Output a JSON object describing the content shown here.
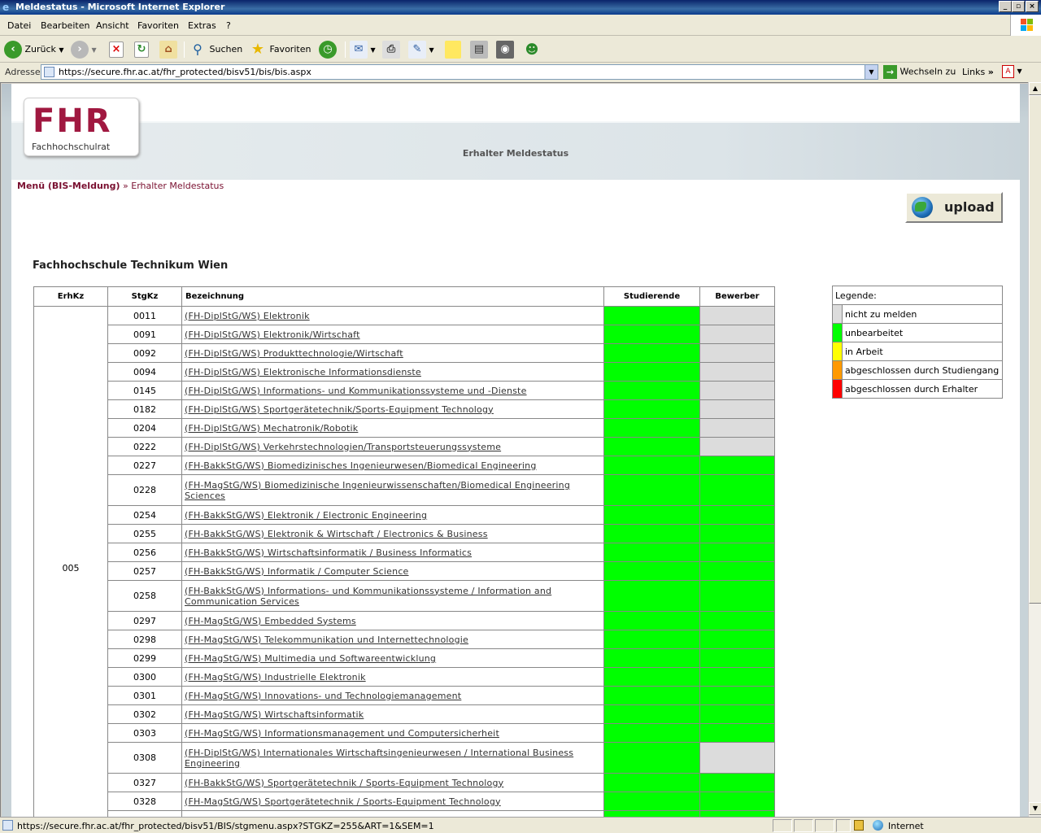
{
  "window": {
    "title": "Meldestatus - Microsoft Internet Explorer"
  },
  "menubar": [
    "Datei",
    "Bearbeiten",
    "Ansicht",
    "Favoriten",
    "Extras",
    "?"
  ],
  "toolbar": {
    "back": "Zurück",
    "search": "Suchen",
    "favorites": "Favoriten"
  },
  "address": {
    "label": "Adresse",
    "url": "https://secure.fhr.ac.at/fhr_protected/bisv51/bis/bis.aspx",
    "go": "Wechseln zu",
    "links": "Links"
  },
  "header": {
    "logo": "FHR",
    "logo_sub": "Fachhochschulrat",
    "title": "Erhalter Meldestatus"
  },
  "breadcrumb": {
    "menu": "Menü (BIS-Meldung)",
    "sep": "»",
    "current": "Erhalter Meldestatus"
  },
  "upload_label": "upload",
  "institution": "Fachhochschule Technikum Wien",
  "table": {
    "headers": [
      "ErhKz",
      "StgKz",
      "Bezeichnung",
      "Studierende",
      "Bewerber"
    ],
    "erhkz": "005",
    "status_colors": {
      "green": "#00ff00",
      "gray": "#dcdcdc"
    },
    "rows": [
      {
        "stgkz": "0011",
        "bez": "(FH-DiplStG/WS) Elektronik",
        "stud": "green",
        "bew": "gray"
      },
      {
        "stgkz": "0091",
        "bez": "(FH-DiplStG/WS) Elektronik/Wirtschaft",
        "stud": "green",
        "bew": "gray"
      },
      {
        "stgkz": "0092",
        "bez": "(FH-DiplStG/WS) Produkttechnologie/Wirtschaft",
        "stud": "green",
        "bew": "gray"
      },
      {
        "stgkz": "0094",
        "bez": "(FH-DiplStG/WS) Elektronische Informationsdienste",
        "stud": "green",
        "bew": "gray"
      },
      {
        "stgkz": "0145",
        "bez": "(FH-DiplStG/WS) Informations- und Kommunikationssysteme und -Dienste",
        "stud": "green",
        "bew": "gray"
      },
      {
        "stgkz": "0182",
        "bez": "(FH-DiplStG/WS) Sportgerätetechnik/Sports-Equipment Technology",
        "stud": "green",
        "bew": "gray"
      },
      {
        "stgkz": "0204",
        "bez": "(FH-DiplStG/WS) Mechatronik/Robotik",
        "stud": "green",
        "bew": "gray"
      },
      {
        "stgkz": "0222",
        "bez": "(FH-DiplStG/WS) Verkehrstechnologien/Transportsteuerungssysteme",
        "stud": "green",
        "bew": "gray"
      },
      {
        "stgkz": "0227",
        "bez": "(FH-BakkStG/WS) Biomedizinisches Ingenieurwesen/Biomedical Engineering",
        "stud": "green",
        "bew": "green"
      },
      {
        "stgkz": "0228",
        "bez": "(FH-MagStG/WS) Biomedizinische Ingenieurwissenschaften/Biomedical Engineering Sciences",
        "stud": "green",
        "bew": "green",
        "tall": true
      },
      {
        "stgkz": "0254",
        "bez": "(FH-BakkStG/WS) Elektronik / Electronic Engineering",
        "stud": "green",
        "bew": "green"
      },
      {
        "stgkz": "0255",
        "bez": "(FH-BakkStG/WS) Elektronik & Wirtschaft / Electronics & Business",
        "stud": "green",
        "bew": "green"
      },
      {
        "stgkz": "0256",
        "bez": "(FH-BakkStG/WS) Wirtschaftsinformatik / Business Informatics",
        "stud": "green",
        "bew": "green"
      },
      {
        "stgkz": "0257",
        "bez": "(FH-BakkStG/WS) Informatik / Computer Science",
        "stud": "green",
        "bew": "green"
      },
      {
        "stgkz": "0258",
        "bez": "(FH-BakkStG/WS) Informations- und Kommunikationssysteme / Information and Communication Services",
        "stud": "green",
        "bew": "green",
        "tall": true
      },
      {
        "stgkz": "0297",
        "bez": "(FH-MagStG/WS) Embedded Systems",
        "stud": "green",
        "bew": "green"
      },
      {
        "stgkz": "0298",
        "bez": "(FH-MagStG/WS) Telekommunikation und Internettechnologie",
        "stud": "green",
        "bew": "green"
      },
      {
        "stgkz": "0299",
        "bez": "(FH-MagStG/WS) Multimedia und Softwareentwicklung",
        "stud": "green",
        "bew": "green"
      },
      {
        "stgkz": "0300",
        "bez": "(FH-MagStG/WS) Industrielle Elektronik",
        "stud": "green",
        "bew": "green"
      },
      {
        "stgkz": "0301",
        "bez": "(FH-MagStG/WS) Innovations- und Technologiemanagement",
        "stud": "green",
        "bew": "green"
      },
      {
        "stgkz": "0302",
        "bez": "(FH-MagStG/WS) Wirtschaftsinformatik",
        "stud": "green",
        "bew": "green"
      },
      {
        "stgkz": "0303",
        "bez": "(FH-MagStG/WS) Informationsmanagement und Computersicherheit",
        "stud": "green",
        "bew": "green"
      },
      {
        "stgkz": "0308",
        "bez": "(FH-DiplStG/WS) Internationales Wirtschaftsingenieurwesen / International Business Engineering",
        "stud": "green",
        "bew": "gray",
        "tall": true
      },
      {
        "stgkz": "0327",
        "bez": "(FH-BakkStG/WS) Sportgerätetechnik / Sports-Equipment Technology",
        "stud": "green",
        "bew": "green"
      },
      {
        "stgkz": "0328",
        "bez": "(FH-MagStG/WS) Sportgerätetechnik / Sports-Equipment Technology",
        "stud": "green",
        "bew": "green"
      },
      {
        "stgkz": "",
        "bez": "",
        "stud": "green",
        "bew": "green"
      }
    ]
  },
  "legend": {
    "title": "Legende:",
    "items": [
      {
        "label": "nicht zu melden",
        "color": "#dcdcdc"
      },
      {
        "label": "unbearbeitet",
        "color": "#00ff00"
      },
      {
        "label": "in Arbeit",
        "color": "#ffff00"
      },
      {
        "label": "abgeschlossen durch Studiengang",
        "color": "#ff9900"
      },
      {
        "label": "abgeschlossen durch Erhalter",
        "color": "#ff0000"
      }
    ]
  },
  "statusbar": {
    "url": "https://secure.fhr.ac.at/fhr_protected/bisv51/BIS/stgmenu.aspx?STGKZ=255&ART=1&SEM=1",
    "zone": "Internet"
  }
}
